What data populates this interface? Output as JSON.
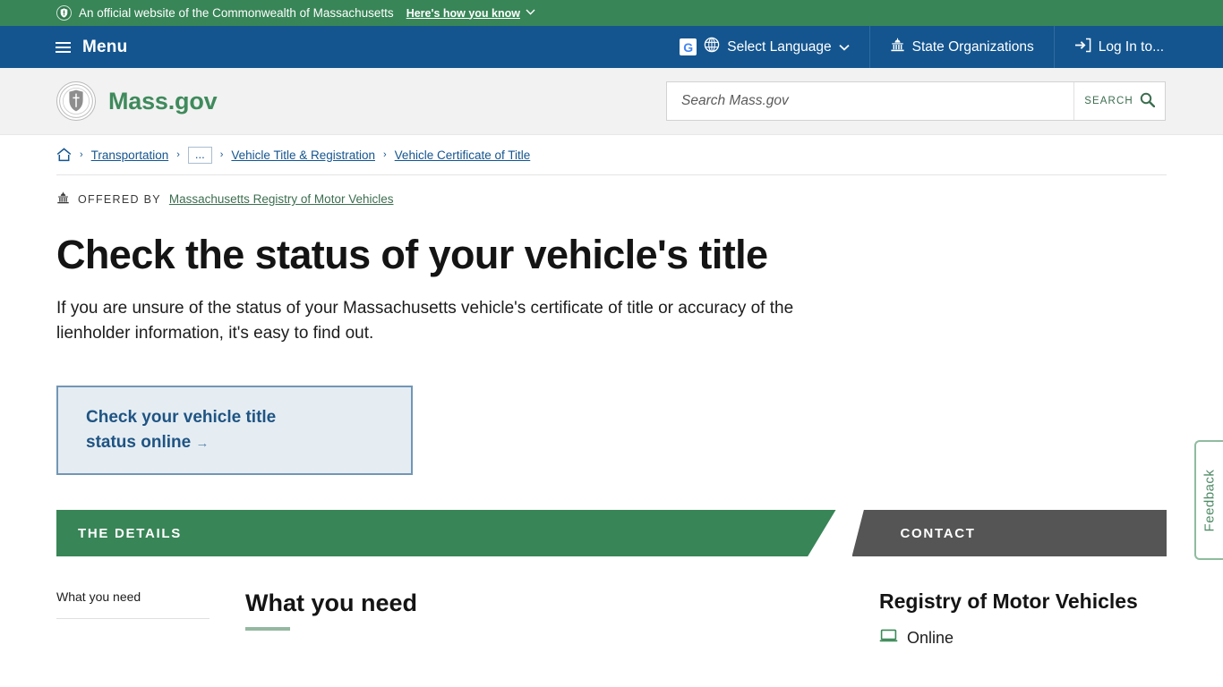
{
  "official_banner": {
    "shield_icon": "shield-badge-icon",
    "text": "An official website of the Commonwealth of Massachusetts",
    "how_you_know_label": "Here's how you know",
    "caret": "⌄",
    "background": "#388557"
  },
  "top_nav": {
    "background": "#14558f",
    "menu_label": "Menu",
    "google_tile": "G",
    "language_label": "Select Language",
    "language_caret": "⌄",
    "state_orgs_label": "State Organizations",
    "login_label": "Log In to..."
  },
  "brand_bar": {
    "logo_text": "Mass.gov",
    "logo_color": "#3f8a5c",
    "search": {
      "placeholder": "Search Mass.gov",
      "value": "",
      "button_label": "SEARCH"
    }
  },
  "breadcrumb": {
    "home_icon": "home-icon",
    "separator": "›",
    "ellipsis": "...",
    "items": [
      {
        "label": "Transportation"
      },
      {
        "label": "Vehicle Title & Registration"
      },
      {
        "label": "Vehicle Certificate of Title"
      }
    ]
  },
  "offered_by": {
    "icon": "capitol-icon",
    "label": "OFFERED BY",
    "org": "Massachusetts Registry of Motor Vehicles"
  },
  "main": {
    "title": "Check the status of your vehicle's title",
    "description": "If you are unsure of the status of your Massachusetts vehicle's certificate of title or accuracy of the lienholder information, it's easy to find out.",
    "cta": {
      "line1": "Check your vehicle title",
      "line2": "status online",
      "arrow": "→",
      "background": "#e5edf3",
      "border_color": "#7296b5",
      "text_color": "#1f5483"
    }
  },
  "banners": {
    "details_label": "THE DETAILS",
    "details_color": "#388557",
    "contact_label": "CONTACT",
    "contact_color": "#555555"
  },
  "details_section": {
    "side_nav": [
      {
        "label": "What you need"
      }
    ],
    "heading": "What you need"
  },
  "contact_section": {
    "org": "Registry of Motor Vehicles",
    "online_icon": "laptop-icon",
    "online_label": "Online"
  },
  "feedback": {
    "label": "Feedback",
    "border_color": "#8fbb9f"
  }
}
